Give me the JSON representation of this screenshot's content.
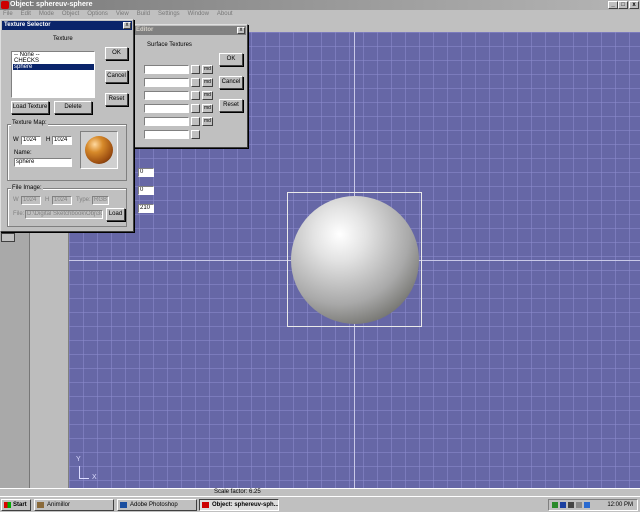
{
  "window": {
    "title": "Object: sphereuv-sphere",
    "min": "_",
    "max": "□",
    "close": "x"
  },
  "menu": [
    "File",
    "Edit",
    "Mode",
    "Object",
    "Options",
    "View",
    "Build",
    "Settings",
    "Window",
    "About"
  ],
  "status": {
    "scale_factor": "Scale factor: 6.25"
  },
  "surface_editor": {
    "title": "Editor",
    "heading": "Surface Textures",
    "md_label": "md",
    "ok": "OK",
    "cancel": "Cancel",
    "reset": "Reset",
    "side_values": [
      "0",
      "0",
      "210"
    ]
  },
  "texture_selector": {
    "title": "Texture Selector",
    "close": "x",
    "texture_label": "Texture",
    "items": [
      "-- None --",
      "CHECKS",
      "sphere"
    ],
    "selected_index": 2,
    "ok": "OK",
    "cancel": "Cancel",
    "reset": "Reset",
    "load_texture": "Load Texture",
    "delete": "Delete",
    "texture_map_label": "Texture Map:",
    "w_label": "W",
    "w_value": "1024",
    "h_label": "H",
    "h_value": "1024",
    "name_label": "Name:",
    "name_value": "sphere",
    "file_image_label": "File Image:",
    "fi_w_value": "1024",
    "fi_h_value": "1024",
    "type_label": "Type:",
    "type_value": "RGB",
    "file_label": "File:",
    "file_value": "D:\\Digital Sketchbook\\Obj\\3d\\",
    "load": "Load"
  },
  "taskbar": {
    "start": "Start",
    "tasks": [
      "Animillor",
      "Adobe Photoshop",
      "Object: sphereuv-sph..."
    ],
    "clock": "12:00 PM"
  },
  "gizmo": {
    "y": "Y",
    "x": "X"
  }
}
